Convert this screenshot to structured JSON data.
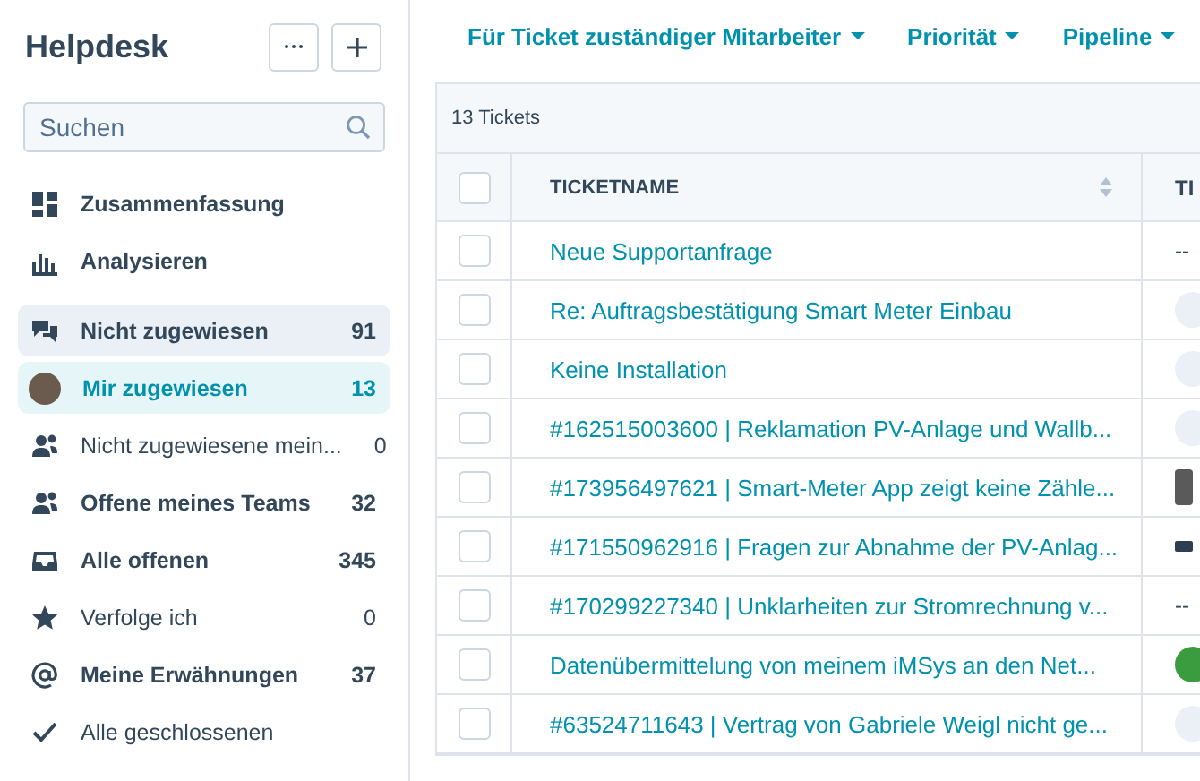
{
  "sidebar": {
    "title": "Helpdesk",
    "search": {
      "placeholder": "Suchen"
    },
    "top_items": [
      {
        "kind": "grid",
        "label": "Zusammenfassung"
      },
      {
        "kind": "chart",
        "label": "Analysieren"
      }
    ],
    "items": [
      {
        "kind": "chat",
        "label": "Nicht zugewiesen",
        "count": "91",
        "bold": true,
        "selected": false,
        "hover": true
      },
      {
        "kind": "avatar",
        "label": "Mir zugewiesen",
        "count": "13",
        "bold": true,
        "selected": true,
        "hover": false
      },
      {
        "kind": "team",
        "label": "Nicht zugewiesene mein...",
        "count": "0",
        "bold": false,
        "selected": false,
        "hover": false
      },
      {
        "kind": "team",
        "label": "Offene meines Teams",
        "count": "32",
        "bold": true,
        "selected": false,
        "hover": false
      },
      {
        "kind": "inbox",
        "label": "Alle offenen",
        "count": "345",
        "bold": true,
        "selected": false,
        "hover": false
      },
      {
        "kind": "star",
        "label": "Verfolge ich",
        "count": "0",
        "bold": false,
        "selected": false,
        "hover": false
      },
      {
        "kind": "at",
        "label": "Meine Erwähnungen",
        "count": "37",
        "bold": true,
        "selected": false,
        "hover": false
      },
      {
        "kind": "check",
        "label": "Alle geschlossenen",
        "bold": false,
        "selected": false,
        "hover": false
      }
    ]
  },
  "filters": [
    "Für Ticket zuständiger Mitarbeiter",
    "Priorität",
    "Pipeline"
  ],
  "table": {
    "count_label": "13 Tickets",
    "columns": [
      "TICKETNAME",
      "TI"
    ],
    "all_checked": false,
    "rows": [
      {
        "name": "Neue Supportanfrage",
        "checked": false,
        "column_2": {
          "kind": "dash",
          "text": "--"
        }
      },
      {
        "name": "Re: Auftragsbestätigung Smart Meter Einbau",
        "checked": false,
        "column_2": {
          "kind": "avatar"
        }
      },
      {
        "name": "Keine Installation",
        "checked": false,
        "column_2": {
          "kind": "avatar"
        }
      },
      {
        "name": "#162515003600 | Reklamation PV-Anlage und Wallb...",
        "checked": false,
        "column_2": {
          "kind": "avatar"
        }
      },
      {
        "name": "#173956497621 | Smart-Meter App zeigt keine Zähle...",
        "checked": false,
        "column_2": {
          "kind": "photo"
        }
      },
      {
        "name": "#171550962916 | Fragen zur Abnahme der PV-Anlag...",
        "checked": false,
        "column_2": {
          "kind": "logo"
        }
      },
      {
        "name": "#170299227340 | Unklarheiten zur Stromrechnung v...",
        "checked": false,
        "column_2": {
          "kind": "dash",
          "text": "--"
        }
      },
      {
        "name": "Datenübermittelung von meinem iMSys an den Net...",
        "checked": false,
        "column_2": {
          "kind": "badge"
        }
      },
      {
        "name": "#63524711643 | Vertrag von Gabriele Weigl nicht ge...",
        "checked": false,
        "column_2": {
          "kind": "avatar"
        }
      }
    ]
  }
}
